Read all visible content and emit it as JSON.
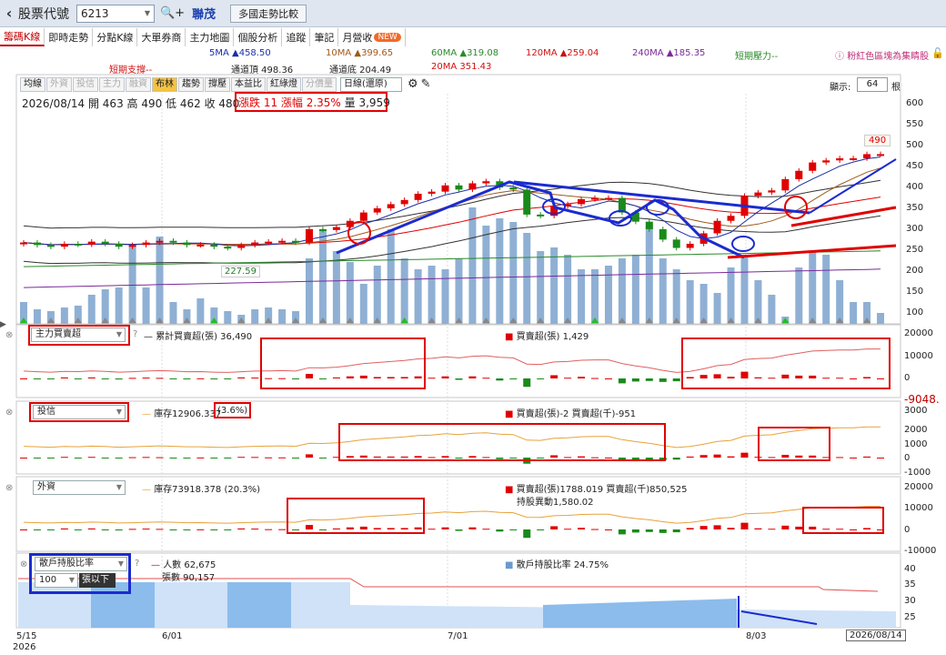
{
  "header": {
    "back_icon": "chevron-left-icon",
    "title": "股票代號",
    "code": "6213",
    "stock_name": "聯茂",
    "compare_button": "多國走勢比較"
  },
  "tabs": [
    {
      "label": "籌碼K線",
      "active": true
    },
    {
      "label": "即時走勢"
    },
    {
      "label": "分點K線"
    },
    {
      "label": "大單券商"
    },
    {
      "label": "主力地圖"
    },
    {
      "label": "個股分析"
    },
    {
      "label": "追蹤"
    },
    {
      "label": "筆記"
    },
    {
      "label": "月營收",
      "badge": "NEW"
    }
  ],
  "legend": {
    "ma5": "5MA ▲458.50",
    "ma10": "10MA ▲399.65",
    "ma60": "60MA ▲319.08",
    "ma120": "120MA ▲259.04",
    "ma240": "240MA ▲185.35",
    "short_pressure": "短期壓力--",
    "short_support": "短期支撐--",
    "channel_top": "通道頂 498.36",
    "channel_bottom": "通道底 204.49",
    "ma20": "20MA 351.43",
    "tip": "粉紅色區塊為集睛股"
  },
  "toolbar": {
    "buttons": [
      "均線",
      "外資",
      "投信",
      "主力",
      "融資",
      "布林",
      "趨勢",
      "撐壓",
      "本益比",
      "紅綠燈",
      "分價量"
    ],
    "period": "日線(還原)",
    "display_label": "顯示:",
    "display_value": "64",
    "display_unit": "根"
  },
  "ohlc": {
    "text": "2026/08/14 開 463  高 490  低 462  收 480",
    "change": "漲跌 11  漲幅 2.35%",
    "volume": "量 3,959"
  },
  "price_axis": [
    "600",
    "550",
    "500",
    "450",
    "400",
    "350",
    "300",
    "250",
    "200",
    "150",
    "100"
  ],
  "price_label_high": "490",
  "price_label_low": "227.59",
  "panel1": {
    "select": "主力買賣超",
    "help": "?",
    "cum_label": "累計買賣超(張) 36,490",
    "net_label": "買賣超(張) 1,429",
    "axis": [
      "20000",
      "10000",
      "0"
    ],
    "value_right": "-9048."
  },
  "panel2": {
    "select": "投信",
    "inventory": "庫存12906.337",
    "inventory_pct": "(3.6%)",
    "net_label": "買賣超(張)-2 買賣超(千)-951",
    "axis": [
      "3000",
      "2000",
      "1000",
      "0",
      "-1000"
    ]
  },
  "panel3": {
    "select": "外資",
    "inventory": "庫存73918.378 (20.3%)",
    "net_label": "買賣超(張)1788.019 買賣超(千)850,525",
    "holding_change": "持股異動1,580.02",
    "axis": [
      "20000",
      "10000",
      "0",
      "-10000"
    ]
  },
  "panel4": {
    "select": "散戶持股比率",
    "help": "?",
    "people": "人數 62,675",
    "shares": "張數 90,157",
    "threshold": "100",
    "threshold_unit": "張以下",
    "ratio": "散戶持股比率 24.75%",
    "axis": [
      "40",
      "35",
      "30",
      "25"
    ]
  },
  "dates": {
    "start": "5/15",
    "start_year": "2026",
    "d1": "6/01",
    "d2": "7/01",
    "d3": "8/03",
    "end": "2026/08/14"
  },
  "colors": {
    "up": "#e00000",
    "down": "#1a8a1a",
    "volume": "#8fb0d4",
    "annotation_blue": "#1b2bd0",
    "annotation_red": "#e00000"
  },
  "chart_data": {
    "type": "candlestick",
    "x": [
      "5/15",
      "6/01",
      "7/01",
      "8/03",
      "2026/08/14"
    ],
    "close": [
      268,
      262,
      258,
      265,
      263,
      270,
      265,
      258,
      262,
      268,
      272,
      268,
      262,
      263,
      258,
      255,
      262,
      268,
      270,
      272,
      268,
      300,
      298,
      305,
      320,
      340,
      350,
      360,
      370,
      385,
      390,
      405,
      395,
      410,
      415,
      400,
      395,
      335,
      332,
      355,
      360,
      372,
      375,
      375,
      340,
      318,
      300,
      275,
      255,
      265,
      290,
      320,
      332,
      380,
      388,
      393,
      420,
      440,
      460,
      465,
      470,
      470,
      480,
      480
    ],
    "volume": [
      60,
      40,
      35,
      45,
      50,
      80,
      95,
      100,
      220,
      100,
      240,
      60,
      40,
      70,
      45,
      35,
      25,
      40,
      45,
      40,
      35,
      180,
      260,
      200,
      170,
      110,
      160,
      260,
      180,
      150,
      160,
      150,
      180,
      320,
      270,
      290,
      280,
      250,
      200,
      210,
      190,
      150,
      150,
      160,
      180,
      190,
      270,
      180,
      150,
      120,
      110,
      85,
      155,
      190,
      120,
      80,
      20,
      155,
      200,
      190,
      120,
      60,
      60,
      30
    ],
    "price_axis_range": [
      75,
      625
    ]
  }
}
